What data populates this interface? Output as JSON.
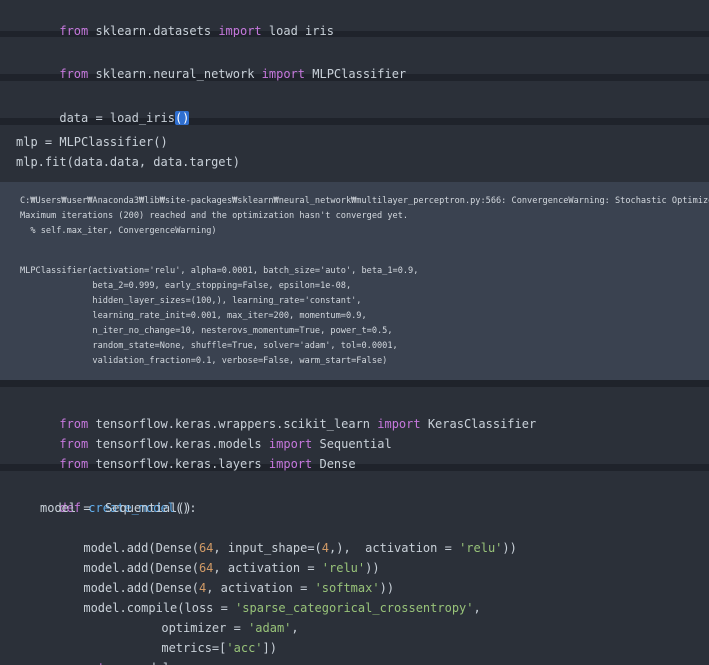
{
  "cells": {
    "c1": {
      "t1": "from",
      "t2": " sklearn.datasets ",
      "t3": "import",
      "t4": " load_iris"
    },
    "c2": {
      "t1": "from",
      "t2": " sklearn.neural_network ",
      "t3": "import",
      "t4": " MLPClassifier"
    },
    "c3": {
      "t1": "data = load_iris",
      "t2": "()"
    },
    "c4": {
      "l1": "mlp = MLPClassifier()",
      "l2": "mlp.fit(data.data, data.target)"
    },
    "c4_output": {
      "warn1": "C:₩Users₩user₩Anaconda3₩lib₩site-packages₩sklearn₩neural_network₩multilayer_perceptron.py:566: ConvergenceWarning: Stochastic Optimizer:",
      "warn2": "Maximum iterations (200) reached and the optimization hasn't converged yet.",
      "warn3": "  % self.max_iter, ConvergenceWarning)",
      "r1": "MLPClassifier(activation='relu', alpha=0.0001, batch_size='auto', beta_1=0.9,",
      "r2": "              beta_2=0.999, early_stopping=False, epsilon=1e-08,",
      "r3": "              hidden_layer_sizes=(100,), learning_rate='constant',",
      "r4": "              learning_rate_init=0.001, max_iter=200, momentum=0.9,",
      "r5": "              n_iter_no_change=10, nesterovs_momentum=True, power_t=0.5,",
      "r6": "              random_state=None, shuffle=True, solver='adam', tol=0.0001,",
      "r7": "              validation_fraction=0.1, verbose=False, warm_start=False)"
    },
    "c5": {
      "l1": {
        "kw1": "from",
        "mod": " tensorflow.keras.wrappers.scikit_learn ",
        "kw2": "import",
        "name": " KerasClassifier"
      },
      "l2": {
        "kw1": "from",
        "mod": " tensorflow.keras.models ",
        "kw2": "import",
        "name": " Sequential"
      },
      "l3": {
        "kw1": "from",
        "mod": " tensorflow.keras.layers ",
        "kw2": "import",
        "name": " Dense"
      }
    },
    "c6": {
      "def_kw": "def",
      "fn_name": " create_model",
      "def_rest": "():",
      "l2": "model =  Sequential()",
      "l3a": "model.add(Dense(",
      "l3n1": "64",
      "l3b": ", input_shape=(",
      "l3n2": "4",
      "l3c": ",),  activation = ",
      "l3s": "'relu'",
      "l3d": "))",
      "l4a": "model.add(Dense(",
      "l4n": "64",
      "l4b": ", activation = ",
      "l4s": "'relu'",
      "l4c": "))",
      "l5a": "model.add(Dense(",
      "l5n": "4",
      "l5b": ", activation = ",
      "l5s": "'softmax'",
      "l5c": "))",
      "l6a": "model.compile(loss = ",
      "l6s": "'sparse_categorical_crossentropy'",
      "l6b": ",",
      "l7a": "optimizer = ",
      "l7s": "'adam'",
      "l7b": ",",
      "l8a": "metrics=[",
      "l8s": "'acc'",
      "l8b": "])",
      "l9kw": "return",
      "l9b": " model"
    }
  },
  "colors": {
    "keyword": "#c678dd",
    "function": "#61afef",
    "string": "#98c379",
    "number": "#d19a66",
    "cell_bg": "#2b3039",
    "output_bg": "#3a4250",
    "page_bg": "#1f232b"
  }
}
